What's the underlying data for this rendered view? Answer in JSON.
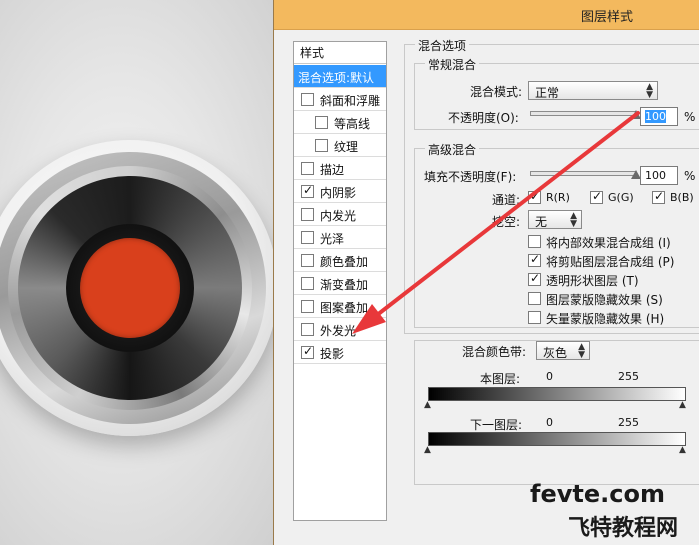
{
  "dialog": {
    "title": "图层样式"
  },
  "styles_panel": {
    "header": "样式",
    "items": [
      {
        "label": "混合选项:默认",
        "selected": true
      },
      {
        "label": "斜面和浮雕",
        "checked": false
      },
      {
        "label": "等高线",
        "checked": false
      },
      {
        "label": "纹理",
        "checked": false
      },
      {
        "label": "描边",
        "checked": false
      },
      {
        "label": "内阴影",
        "checked": true
      },
      {
        "label": "内发光",
        "checked": false
      },
      {
        "label": "光泽",
        "checked": false
      },
      {
        "label": "颜色叠加",
        "checked": false
      },
      {
        "label": "渐变叠加",
        "checked": false
      },
      {
        "label": "图案叠加",
        "checked": false
      },
      {
        "label": "外发光",
        "checked": false
      },
      {
        "label": "投影",
        "checked": true
      }
    ]
  },
  "blend_options": {
    "title": "混合选项",
    "general": {
      "title": "常规混合",
      "mode_label": "混合模式:",
      "mode_value": "正常",
      "opacity_label": "不透明度(O):",
      "opacity_value": "100",
      "opacity_unit": "%",
      "opacity_level": 1.0
    },
    "advanced": {
      "title": "高级混合",
      "fill_label": "填充不透明度(F):",
      "fill_value": "100",
      "fill_unit": "%",
      "fill_level": 1.0,
      "channels_label": "通道:",
      "channels": [
        {
          "label": "R(R)",
          "checked": true
        },
        {
          "label": "G(G)",
          "checked": true
        },
        {
          "label": "B(B)",
          "checked": true
        }
      ],
      "knockout_label": "挖空:",
      "knockout_value": "无",
      "options": [
        {
          "label": "将内部效果混合成组 (I)",
          "checked": false
        },
        {
          "label": "将剪贴图层混合成组 (P)",
          "checked": true
        },
        {
          "label": "透明形状图层 (T)",
          "checked": true
        },
        {
          "label": "图层蒙版隐藏效果 (S)",
          "checked": false
        },
        {
          "label": "矢量蒙版隐藏效果 (H)",
          "checked": false
        }
      ]
    },
    "blend_if": {
      "label": "混合颜色带:",
      "value": "灰色",
      "this_layer": {
        "label": "本图层:",
        "min": "0",
        "max": "255"
      },
      "underlying_layer": {
        "label": "下一图层:",
        "min": "0",
        "max": "255"
      }
    }
  },
  "watermark": {
    "line1": "fevte.com",
    "line2": "飞特教程网"
  },
  "colors": {
    "titlebar": "#f3b95e",
    "selection": "#3399ff",
    "arrow": "#e8383a",
    "dial_center": "#d9401c"
  }
}
